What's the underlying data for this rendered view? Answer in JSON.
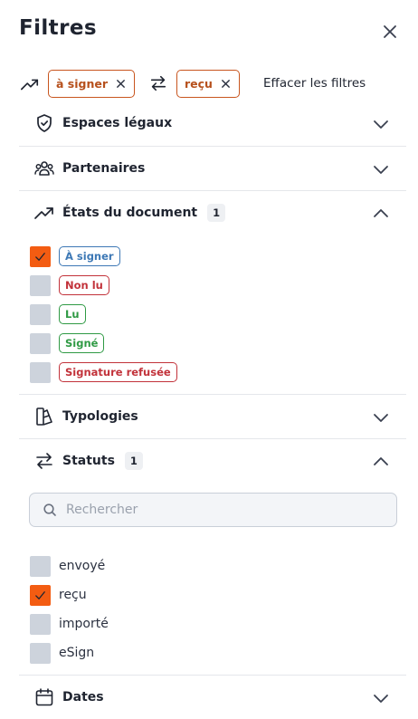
{
  "header": {
    "title": "Filtres",
    "close_icon": "close-icon"
  },
  "active_filters": {
    "trend_icon": "trending-up-icon",
    "swap_icon": "arrows-swap-icon",
    "chips": [
      {
        "label": "à signer",
        "remove_icon": "x-icon"
      },
      {
        "label": "reçu",
        "remove_icon": "x-icon"
      }
    ],
    "clear_label": "Effacer les filtres",
    "accent": "#c8551e"
  },
  "sections": {
    "espaces": {
      "label": "Espaces légaux",
      "icon": "shield-check-icon",
      "expanded": false
    },
    "partenaires": {
      "label": "Partenaires",
      "icon": "users-icon",
      "expanded": false
    },
    "etats": {
      "label": "États du document",
      "icon": "trending-up-icon",
      "count": "1",
      "expanded": true,
      "options": [
        {
          "label": "À signer",
          "checked": true,
          "color": "#3d78b5"
        },
        {
          "label": "Non lu",
          "checked": false,
          "color": "#c2323a"
        },
        {
          "label": "Lu",
          "checked": false,
          "color": "#2f9a44"
        },
        {
          "label": "Signé",
          "checked": false,
          "color": "#2f9a44"
        },
        {
          "label": "Signature refusée",
          "checked": false,
          "color": "#c2323a"
        }
      ]
    },
    "typologies": {
      "label": "Typologies",
      "icon": "shapes-icon",
      "expanded": false
    },
    "statuts": {
      "label": "Statuts",
      "icon": "arrows-swap-icon",
      "count": "1",
      "expanded": true,
      "search_placeholder": "Rechercher",
      "search_value": "",
      "options": [
        {
          "label": "envoyé",
          "checked": false
        },
        {
          "label": "reçu",
          "checked": true
        },
        {
          "label": "importé",
          "checked": false
        },
        {
          "label": "eSign",
          "checked": false
        }
      ]
    },
    "dates": {
      "label": "Dates",
      "icon": "calendar-icon",
      "expanded": false
    }
  },
  "colors": {
    "checkbox_on": "#f35c12",
    "checkbox_off": "#cdd3dc",
    "text": "#1f2430",
    "divider": "#e5e7eb"
  }
}
